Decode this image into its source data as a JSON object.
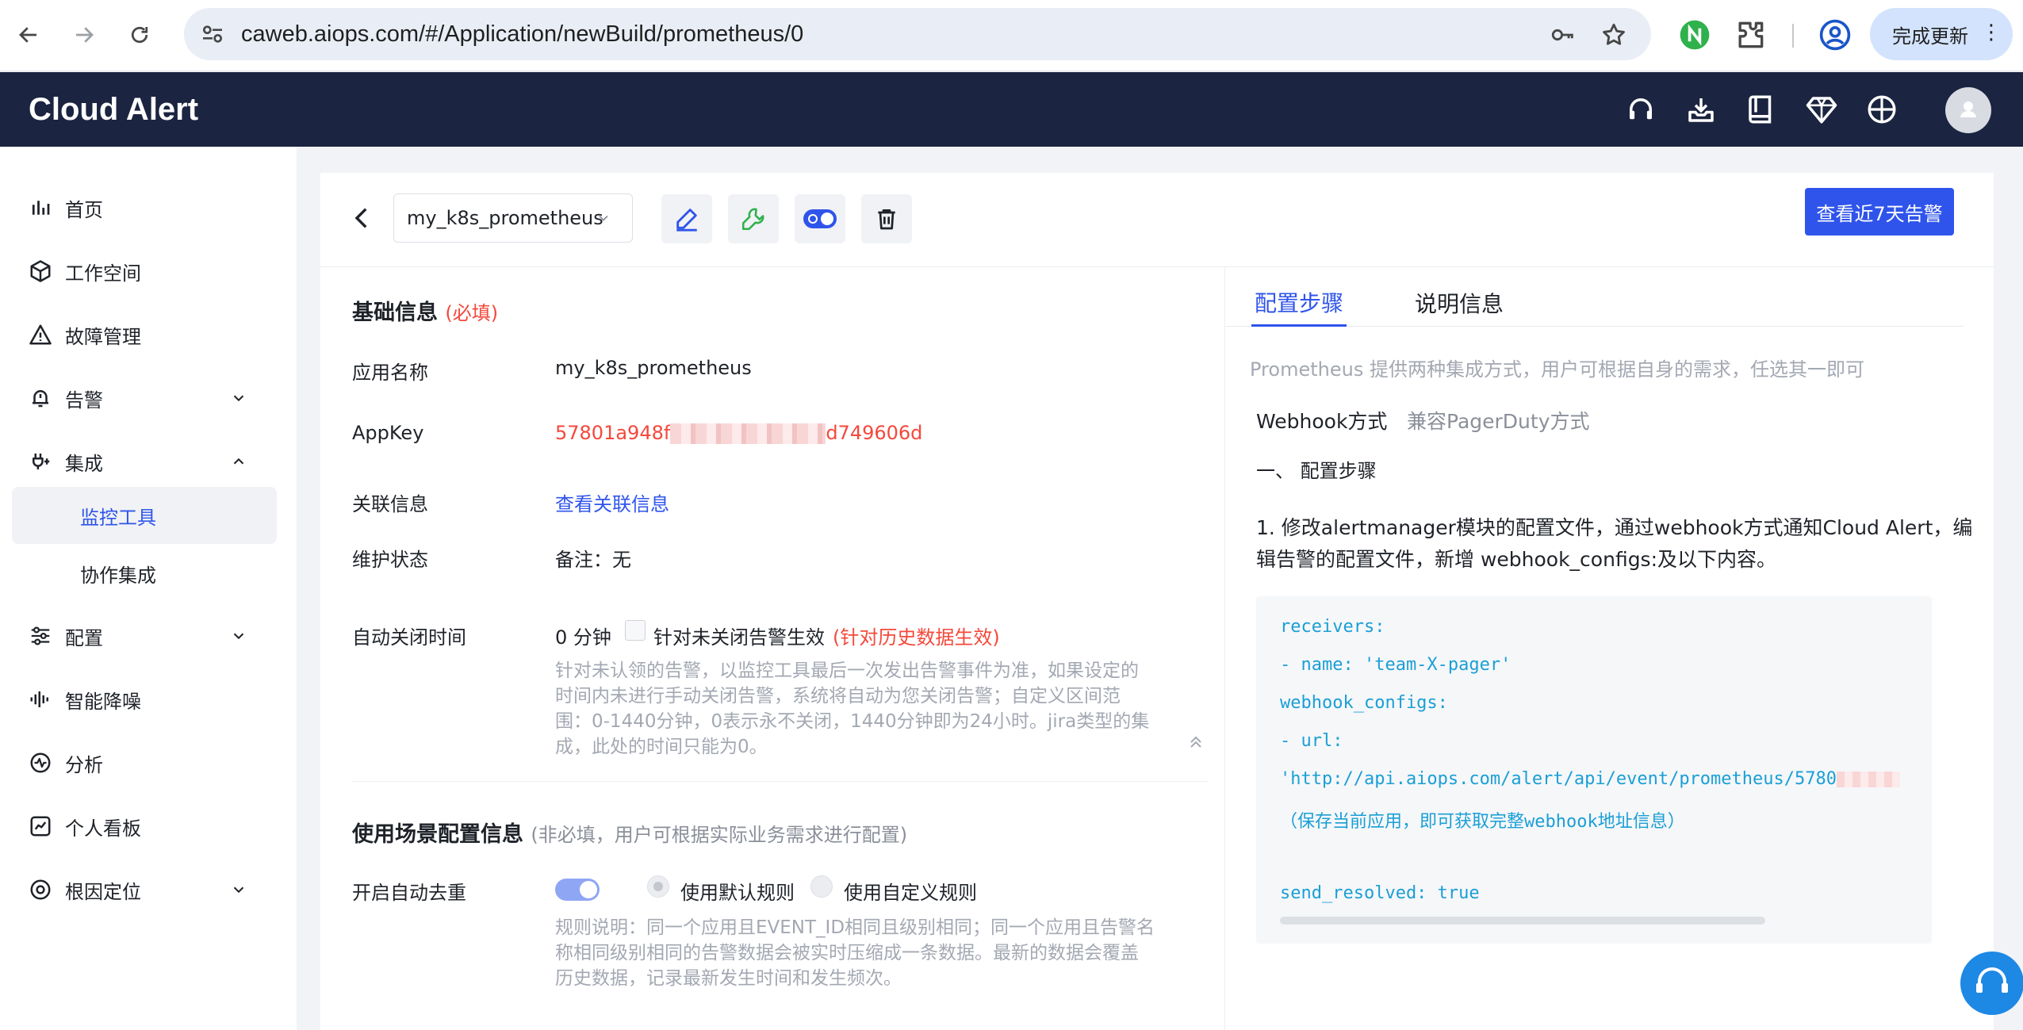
{
  "browser": {
    "url": "caweb.aiops.com/#/Application/newBuild/prometheus/0",
    "update_label": "完成更新"
  },
  "header": {
    "brand": "Cloud Alert"
  },
  "sidebar": {
    "items": [
      {
        "label": "首页"
      },
      {
        "label": "工作空间"
      },
      {
        "label": "故障管理"
      },
      {
        "label": "告警"
      },
      {
        "label": "集成"
      },
      {
        "label": "监控工具"
      },
      {
        "label": "协作集成"
      },
      {
        "label": "配置"
      },
      {
        "label": "智能降噪"
      },
      {
        "label": "分析"
      },
      {
        "label": "个人看板"
      },
      {
        "label": "根因定位"
      }
    ]
  },
  "toolbar": {
    "app_selector": "my_k8s_prometheus",
    "view_alerts_label": "查看近7天告警"
  },
  "basic": {
    "title": "基础信息",
    "required": "(必填)",
    "app_name_label": "应用名称",
    "app_name_value": "my_k8s_prometheus",
    "appkey_label": "AppKey",
    "appkey_prefix": "57801a948f",
    "appkey_suffix": "d749606d",
    "related_label": "关联信息",
    "related_link": "查看关联信息",
    "maint_label": "维护状态",
    "maint_value": "备注：无",
    "autoclose_label": "自动关闭时间",
    "autoclose_value": "0 分钟",
    "autoclose_check": "针对未关闭告警生效",
    "autoclose_history": "(针对历史数据生效)",
    "autoclose_hint": [
      "针对未认领的告警，以监控工具最后一次发出告警事件为准，如果设定的",
      "时间内未进行手动关闭告警，系统将自动为您关闭告警；自定义区间范",
      "围：0-1440分钟，0表示永不关闭，1440分钟即为24小时。jira类型的集",
      "成，此处的时间只能为0。"
    ]
  },
  "scene": {
    "title": "使用场景配置信息",
    "note": "(非必填，用户可根据实际业务需求进行配置)",
    "dedup_label": "开启自动去重",
    "radio_default": "使用默认规则",
    "radio_custom": "使用自定义规则",
    "dedup_hint": [
      "规则说明：同一个应用且EVENT_ID相同且级别相同；同一个应用且告警名",
      "称相同级别相同的告警数据会被实时压缩成一条数据。最新的数据会覆盖",
      "历史数据，记录最新发生时间和发生频次。"
    ]
  },
  "right": {
    "tabs": [
      {
        "label": "配置步骤"
      },
      {
        "label": "说明信息"
      }
    ],
    "intro": "Prometheus 提供两种集成方式，用户可根据自身的需求，任选其一即可",
    "method_webhook": "Webhook方式",
    "method_pagerduty": "兼容PagerDuty方式",
    "step_heading": "一、 配置步骤",
    "step1": [
      "1. 修改alertmanager模块的配置文件，通过webhook方式通知Cloud Alert，编",
      "辑告警的配置文件，新增 webhook_configs:及以下内容。"
    ],
    "code": [
      "receivers:",
      "- name: 'team-X-pager'",
      "webhook_configs:",
      "- url:",
      "'http://api.aiops.com/alert/api/event/prometheus/5780",
      "（保存当前应用，即可获取完整webhook地址信息）",
      "",
      "send_resolved: true"
    ]
  },
  "colors": {
    "header_bg": "#1b2440",
    "primary": "#2f54eb",
    "danger": "#f5483b",
    "code": "#1a9fd6"
  }
}
